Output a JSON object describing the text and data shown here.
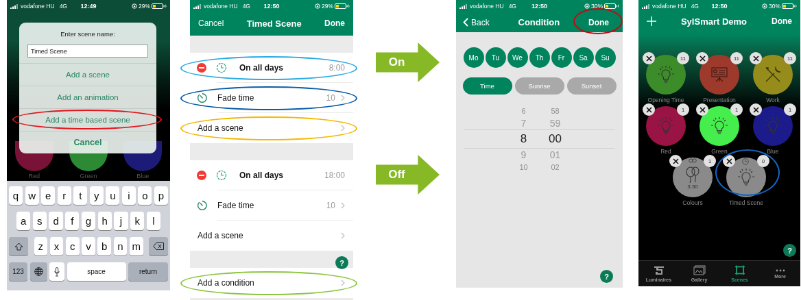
{
  "dialog_screen": {
    "status_bar": {
      "carrier": "vodafone HU",
      "network": "4G",
      "time": "12:49",
      "battery": "29%"
    },
    "background_scenes": [
      {
        "label": "Red",
        "color": "#7a1238"
      },
      {
        "label": "Green",
        "color": "#2c8a35"
      },
      {
        "label": "Blue",
        "color": "#1c1c78"
      }
    ],
    "dialog": {
      "prompt": "Enter scene name:",
      "name_value": "Timed Scene",
      "options": [
        {
          "kind": "option",
          "label": "Add a scene"
        },
        {
          "kind": "option",
          "label": "Add an animation"
        },
        {
          "kind": "option",
          "label": "Add a time based scene",
          "highlight": {
            "color": "#e3141c"
          }
        },
        {
          "kind": "cancel",
          "label": "Cancel"
        }
      ]
    },
    "keyboard": {
      "key_rows": [
        {
          "keys": [
            {
              "kind": "letter",
              "label": "q"
            },
            {
              "kind": "letter",
              "label": "w"
            },
            {
              "kind": "letter",
              "label": "e"
            },
            {
              "kind": "letter",
              "label": "r"
            },
            {
              "kind": "letter",
              "label": "t"
            },
            {
              "kind": "letter",
              "label": "y"
            },
            {
              "kind": "letter",
              "label": "u"
            },
            {
              "kind": "letter",
              "label": "i"
            },
            {
              "kind": "letter",
              "label": "o"
            },
            {
              "kind": "letter",
              "label": "p"
            }
          ]
        },
        {
          "keys": [
            {
              "kind": "letter",
              "label": "a"
            },
            {
              "kind": "letter",
              "label": "s"
            },
            {
              "kind": "letter",
              "label": "d"
            },
            {
              "kind": "letter",
              "label": "f"
            },
            {
              "kind": "letter",
              "label": "g"
            },
            {
              "kind": "letter",
              "label": "h"
            },
            {
              "kind": "letter",
              "label": "j"
            },
            {
              "kind": "letter",
              "label": "k"
            },
            {
              "kind": "letter",
              "label": "l"
            }
          ]
        },
        {
          "keys": [
            {
              "kind": "shift"
            },
            {
              "kind": "letter",
              "label": "z"
            },
            {
              "kind": "letter",
              "label": "x"
            },
            {
              "kind": "letter",
              "label": "c"
            },
            {
              "kind": "letter",
              "label": "v"
            },
            {
              "kind": "letter",
              "label": "b"
            },
            {
              "kind": "letter",
              "label": "n"
            },
            {
              "kind": "letter",
              "label": "m"
            },
            {
              "kind": "backspace"
            }
          ]
        },
        {
          "keys": [
            {
              "kind": "numbers",
              "label": "123"
            },
            {
              "kind": "globe"
            },
            {
              "kind": "mic"
            },
            {
              "kind": "space",
              "label": "space"
            },
            {
              "kind": "return",
              "label": "return"
            }
          ]
        }
      ]
    }
  },
  "timed_scene_screen": {
    "status_bar": {
      "carrier": "vodafone HU",
      "network": "4G",
      "time": "12:50",
      "battery": "29%"
    },
    "nav": {
      "cancel": "Cancel",
      "title": "Timed Scene",
      "done": "Done"
    },
    "sections": [
      {
        "rows": [
          {
            "kind": "schedule",
            "label": "On all days",
            "value": "8:00",
            "highlight": {
              "color": "#29abe2"
            }
          },
          {
            "kind": "fade",
            "label": "Fade time",
            "value": "10",
            "highlight": {
              "color": "#0a5ca8"
            }
          },
          {
            "kind": "add",
            "label": "Add a scene",
            "highlight": {
              "color": "#f5b800"
            }
          }
        ]
      },
      {
        "rows": [
          {
            "kind": "schedule",
            "label": "On all days",
            "value": "18:00"
          },
          {
            "kind": "fade",
            "label": "Fade time",
            "value": "10"
          },
          {
            "kind": "add",
            "label": "Add a scene"
          }
        ]
      },
      {
        "rows": [
          {
            "kind": "add",
            "label": "Add a condition",
            "highlight": {
              "color": "#8cc63f"
            }
          }
        ]
      }
    ],
    "help": "?"
  },
  "arrows": [
    {
      "label": "On"
    },
    {
      "label": "Off"
    }
  ],
  "condition_screen": {
    "status_bar": {
      "carrier": "vodafone HU",
      "network": "4G",
      "time": "12:50",
      "battery": "30%"
    },
    "nav": {
      "back": "Back",
      "title": "Condition",
      "done": "Done",
      "done_highlight": {
        "color": "#c00a12"
      }
    },
    "days": [
      {
        "label": "Mo",
        "selected": true
      },
      {
        "label": "Tu",
        "selected": true
      },
      {
        "label": "We",
        "selected": true
      },
      {
        "label": "Th",
        "selected": true
      },
      {
        "label": "Fr",
        "selected": true
      },
      {
        "label": "Sa",
        "selected": true
      },
      {
        "label": "Su",
        "selected": true
      }
    ],
    "modes": [
      {
        "label": "Time",
        "selected": true
      },
      {
        "label": "Sunrise",
        "selected": false
      },
      {
        "label": "Sunset",
        "selected": false
      }
    ],
    "picker": {
      "hours": [
        {
          "value": "6",
          "selected": false
        },
        {
          "value": "7",
          "selected": false
        },
        {
          "value": "8",
          "selected": true
        },
        {
          "value": "9",
          "selected": false
        },
        {
          "value": "10",
          "selected": false
        }
      ],
      "minutes": [
        {
          "value": "58",
          "selected": false
        },
        {
          "value": "59",
          "selected": false
        },
        {
          "value": "00",
          "selected": true
        },
        {
          "value": "01",
          "selected": false
        },
        {
          "value": "02",
          "selected": false
        }
      ]
    },
    "help": "?"
  },
  "scenes_screen": {
    "status_bar": {
      "carrier": "vodafone HU",
      "network": "4G",
      "time": "12:50",
      "battery": "30%"
    },
    "nav": {
      "title": "SylSmart Demo",
      "done": "Done"
    },
    "scene_rows": [
      [
        {
          "name": "Opening Time",
          "count": "11",
          "color": "#3d8c2a",
          "kind": "bulb"
        },
        {
          "name": "Presentation",
          "count": "11",
          "color": "#9e3a2c",
          "kind": "presentation"
        },
        {
          "name": "Work",
          "count": "11",
          "color": "#968c1c",
          "kind": "tools"
        }
      ],
      [
        {
          "name": "Red",
          "count": "1",
          "color": "#9a1345",
          "kind": "bulb"
        },
        {
          "name": "Green",
          "count": "1",
          "color": "#45ee4c",
          "kind": "bulb"
        },
        {
          "name": "Blue",
          "count": "1",
          "color": "#1b1b8c",
          "kind": "bulb"
        }
      ],
      [
        {
          "name": "Colours",
          "count": "1",
          "color": "#8a8a8a",
          "kind": "animation",
          "timer": "3:30"
        },
        {
          "name": "Timed Scene",
          "count": "0",
          "color": "#8a8a8a",
          "kind": "timed",
          "highlight": {
            "color": "#1565c0"
          }
        }
      ]
    ],
    "help": "?",
    "tabs": [
      {
        "label": "Luminaires",
        "kind": "luminaires",
        "selected": false
      },
      {
        "label": "Gallery",
        "kind": "gallery",
        "selected": false
      },
      {
        "label": "Scenes",
        "kind": "scenes",
        "selected": true
      },
      {
        "label": "More",
        "kind": "more",
        "selected": false
      }
    ]
  }
}
